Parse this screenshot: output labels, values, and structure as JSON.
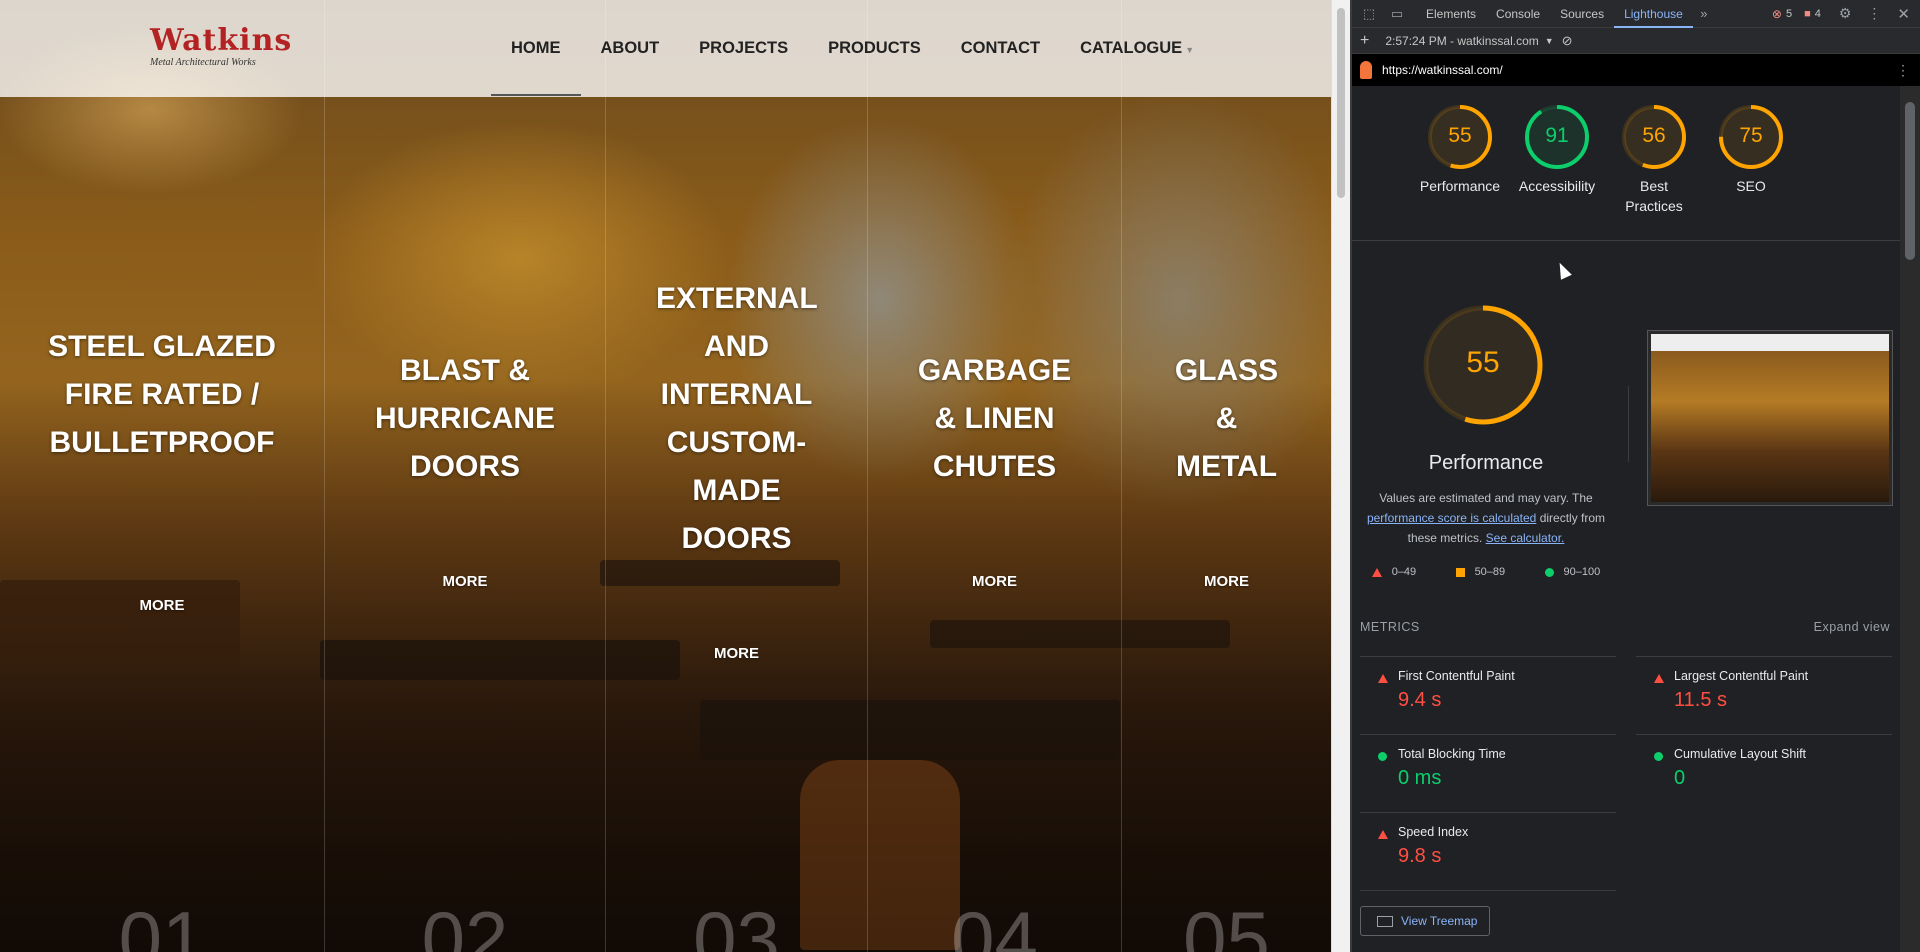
{
  "site": {
    "logo_text": "Watkins",
    "logo_tagline": "Metal Architectural Works",
    "nav": [
      {
        "label": "HOME",
        "active": true
      },
      {
        "label": "ABOUT"
      },
      {
        "label": "PROJECTS"
      },
      {
        "label": "PRODUCTS"
      },
      {
        "label": "CONTACT"
      },
      {
        "label": "CATALOGUE"
      }
    ],
    "columns": [
      {
        "title": "STEEL GLAZED FIRE RATED / BULLETPROOF",
        "more": "MORE",
        "number": "01"
      },
      {
        "title": "BLAST & HURRICANE DOORS",
        "more": "MORE",
        "number": "02"
      },
      {
        "title": "EXTERNAL AND INTERNAL CUSTOM-MADE DOORS",
        "more": "MORE",
        "number": "03"
      },
      {
        "title": "GARBAGE & LINEN CHUTES",
        "more": "MORE",
        "number": "04"
      },
      {
        "title": "GLASS & METAL",
        "more": "MORE",
        "number": "05"
      }
    ]
  },
  "devtools": {
    "tabs": [
      "Elements",
      "Console",
      "Sources",
      "Lighthouse"
    ],
    "active_tab": "Lighthouse",
    "error_count": "5",
    "warning_count": "4",
    "report_time": "2:57:24 PM - watkinssal.com",
    "url": "https://watkinssal.com/",
    "scores": [
      {
        "label": "Performance",
        "value": 55,
        "color": "#ffa400"
      },
      {
        "label": "Accessibility",
        "value": 91,
        "color": "#0cce6b"
      },
      {
        "label": "Best Practices",
        "value": 56,
        "color": "#ffa400"
      },
      {
        "label": "SEO",
        "value": 75,
        "color": "#ffa400"
      }
    ],
    "perf": {
      "score": "55",
      "title": "Performance",
      "desc_pre": "Values are estimated and may vary. The",
      "desc_link": "performance score is calculated",
      "desc_mid": "directly from these metrics.",
      "desc_link2": "See calculator."
    },
    "legend": [
      "0–49",
      "50–89",
      "90–100"
    ],
    "metrics_header": "METRICS",
    "expand_view": "Expand view",
    "metrics": [
      {
        "name": "First Contentful Paint",
        "value": "9.4 s",
        "status": "red"
      },
      {
        "name": "Largest Contentful Paint",
        "value": "11.5 s",
        "status": "red"
      },
      {
        "name": "Total Blocking Time",
        "value": "0 ms",
        "status": "green"
      },
      {
        "name": "Cumulative Layout Shift",
        "value": "0",
        "status": "green"
      },
      {
        "name": "Speed Index",
        "value": "9.8 s",
        "status": "red"
      }
    ],
    "treemap_button": "View Treemap"
  }
}
